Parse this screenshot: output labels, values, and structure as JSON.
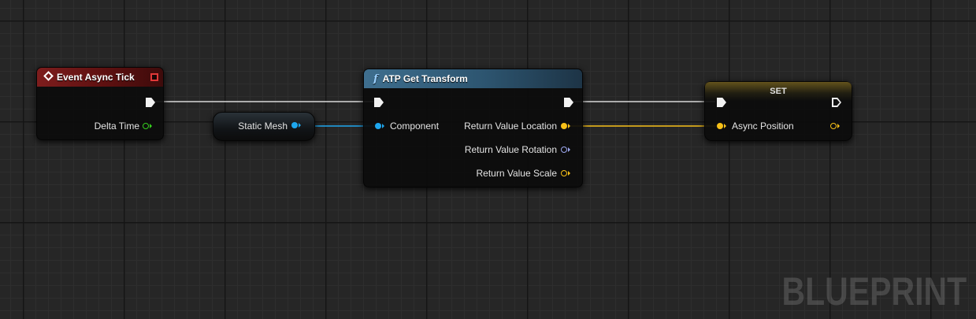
{
  "graph": {
    "watermark": "BLUEPRINT"
  },
  "colors": {
    "exec_pin": "#f2f2f2",
    "float_pin": "#36d01e",
    "object_pin": "#1ea7ef",
    "vector_pin": "#f7c018",
    "rotator_pin": "#9da8ef",
    "event_header": "#7d1d1d",
    "function_header": "#3e6e8e",
    "set_header": "#aa8c28"
  },
  "nodes": {
    "event_async_tick": {
      "title": "Event Async Tick",
      "pins": {
        "delta_time": "Delta Time"
      }
    },
    "static_mesh": {
      "label": "Static Mesh"
    },
    "atp_get_transform": {
      "title": "ATP Get Transform",
      "icon": "f",
      "pins": {
        "component": "Component",
        "return_location": "Return Value Location",
        "return_rotation": "Return Value Rotation",
        "return_scale": "Return Value Scale"
      }
    },
    "set_node": {
      "title": "SET",
      "pins": {
        "async_position": "Async Position"
      }
    }
  }
}
